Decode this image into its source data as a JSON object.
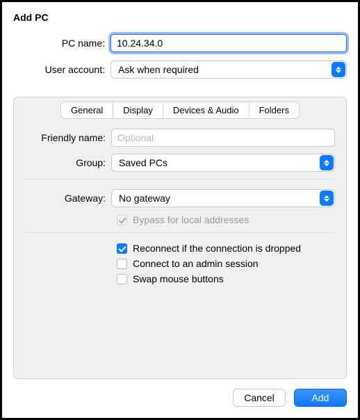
{
  "title": "Add PC",
  "pc_name": {
    "label": "PC name:",
    "value": "10.24.34.0"
  },
  "user_account": {
    "label": "User account:",
    "value": "Ask when required"
  },
  "tabs": {
    "items": [
      {
        "label": "General",
        "active": true
      },
      {
        "label": "Display",
        "active": false
      },
      {
        "label": "Devices & Audio",
        "active": false
      },
      {
        "label": "Folders",
        "active": false
      }
    ]
  },
  "friendly_name": {
    "label": "Friendly name:",
    "placeholder": "Optional",
    "value": ""
  },
  "group": {
    "label": "Group:",
    "value": "Saved PCs"
  },
  "gateway": {
    "label": "Gateway:",
    "value": "No gateway"
  },
  "bypass": {
    "label": "Bypass for local addresses",
    "checked": true,
    "disabled": true
  },
  "options": {
    "reconnect": {
      "label": "Reconnect if the connection is dropped",
      "checked": true
    },
    "admin": {
      "label": "Connect to an admin session",
      "checked": false
    },
    "swap": {
      "label": "Swap mouse buttons",
      "checked": false
    }
  },
  "footer": {
    "cancel": "Cancel",
    "add": "Add"
  }
}
